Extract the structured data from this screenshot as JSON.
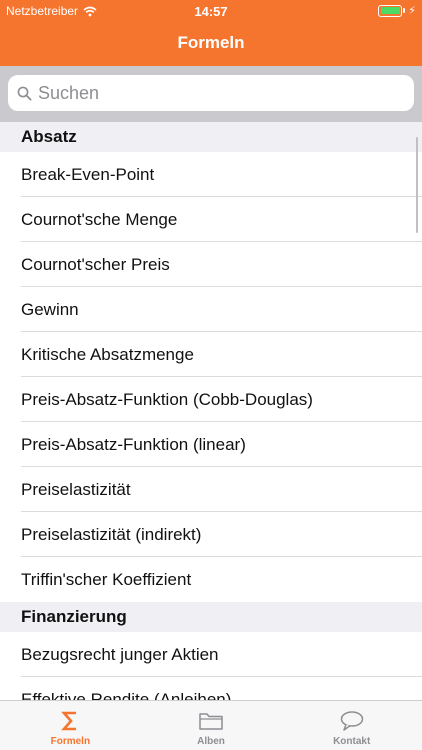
{
  "status_bar": {
    "carrier": "Netzbetreiber",
    "time": "14:57"
  },
  "nav": {
    "title": "Formeln"
  },
  "search": {
    "placeholder": "Suchen"
  },
  "sections": [
    {
      "title": "Absatz",
      "items": [
        "Break-Even-Point",
        "Cournot'sche Menge",
        "Cournot'scher Preis",
        "Gewinn",
        "Kritische Absatzmenge",
        "Preis-Absatz-Funktion (Cobb-Douglas)",
        "Preis-Absatz-Funktion (linear)",
        "Preiselastizität",
        "Preiselastizität (indirekt)",
        "Triffin'scher Koeffizient"
      ]
    },
    {
      "title": "Finanzierung",
      "items": [
        "Bezugsrecht junger Aktien",
        "Effektive Rendite (Anleihen)"
      ]
    }
  ],
  "tabs": [
    {
      "label": "Formeln",
      "icon": "sigma-icon",
      "active": true
    },
    {
      "label": "Alben",
      "icon": "folder-icon",
      "active": false
    },
    {
      "label": "Kontakt",
      "icon": "speech-bubble-icon",
      "active": false
    }
  ],
  "colors": {
    "accent": "#f5752f",
    "inactive": "#8e8e93",
    "battery": "#4cd964"
  }
}
